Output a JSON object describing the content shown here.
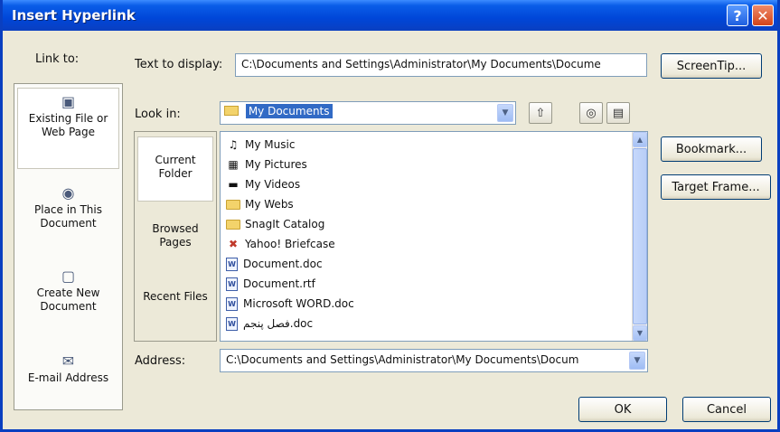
{
  "window": {
    "title": "Insert Hyperlink",
    "help_label": "?",
    "close_label": "✕"
  },
  "link_to": {
    "label": "Link to:",
    "items": [
      {
        "label": "Existing File or Web Page",
        "icon": "web-page-icon",
        "selected": true
      },
      {
        "label": "Place in This Document",
        "icon": "document-place-icon",
        "selected": false
      },
      {
        "label": "Create New Document",
        "icon": "new-document-icon",
        "selected": false
      },
      {
        "label": "E-mail Address",
        "icon": "email-icon",
        "selected": false
      }
    ]
  },
  "text_to_display": {
    "label": "Text to display:",
    "value": "C:\\Documents and Settings\\Administrator\\My Documents\\Docume"
  },
  "look_in": {
    "label": "Look in:",
    "value": "My Documents"
  },
  "sub_nav": [
    {
      "label": "Current Folder",
      "selected": true
    },
    {
      "label": "Browsed Pages",
      "selected": false
    },
    {
      "label": "Recent Files",
      "selected": false
    }
  ],
  "files": [
    {
      "name": "My Music",
      "type": "music-folder"
    },
    {
      "name": "My Pictures",
      "type": "pictures-folder"
    },
    {
      "name": "My Videos",
      "type": "videos-folder"
    },
    {
      "name": "My Webs",
      "type": "folder"
    },
    {
      "name": "SnagIt Catalog",
      "type": "folder"
    },
    {
      "name": "Yahoo! Briefcase",
      "type": "briefcase"
    },
    {
      "name": "Document.doc",
      "type": "doc"
    },
    {
      "name": "Document.rtf",
      "type": "doc"
    },
    {
      "name": "Microsoft WORD.doc",
      "type": "doc"
    },
    {
      "name": "فصل پنجم.doc",
      "type": "doc"
    }
  ],
  "address": {
    "label": "Address:",
    "value": "C:\\Documents and Settings\\Administrator\\My Documents\\Docum"
  },
  "buttons": {
    "screentip": "ScreenTip...",
    "bookmark": "Bookmark...",
    "target_frame": "Target Frame...",
    "ok": "OK",
    "cancel": "Cancel"
  },
  "colors": {
    "titlebar": "#0a5de8",
    "dialog_bg": "#ece9d8",
    "selection": "#316ac5"
  }
}
